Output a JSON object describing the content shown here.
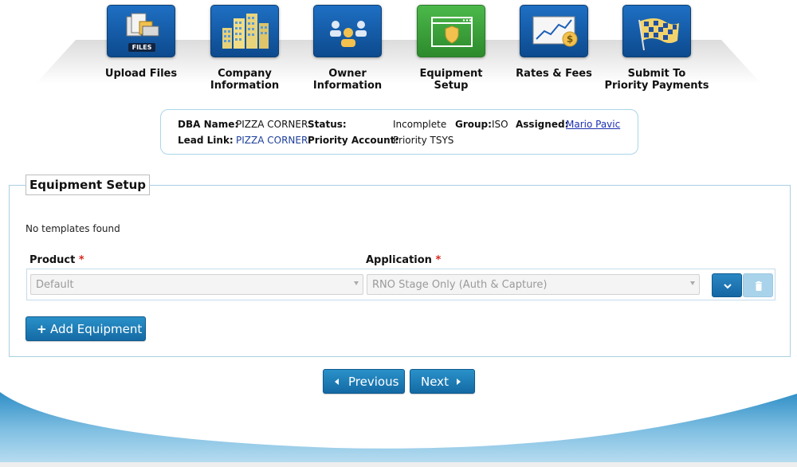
{
  "steps": [
    {
      "label_line1": "Upload Files",
      "label_line2": "",
      "tile_text": "FILES",
      "icon": "files-icon"
    },
    {
      "label_line1": "Company",
      "label_line2": "Information",
      "icon": "buildings-icon"
    },
    {
      "label_line1": "Owner",
      "label_line2": "Information",
      "icon": "people-icon"
    },
    {
      "label_line1": "Equipment",
      "label_line2": "Setup",
      "icon": "browser-shield-icon",
      "active": true
    },
    {
      "label_line1": "Rates & Fees",
      "label_line2": "",
      "icon": "chart-dollar-icon"
    },
    {
      "label_line1": "Submit To",
      "label_line2": "Priority Payments",
      "icon": "checkered-flag-icon"
    }
  ],
  "merchant": {
    "dba_label": "DBA Name:",
    "dba_value": "PIZZA CORNER",
    "status_label": "Status:",
    "status_value": "Incomplete",
    "group_label": "Group:",
    "group_value": "ISO",
    "assigned_label": "Assigned:",
    "assigned_value": "Mario Pavic",
    "lead_label": "Lead Link:",
    "lead_value": "PIZZA CORNER",
    "priority_label": "Priority Account:",
    "priority_value": "Priority TSYS"
  },
  "equipment": {
    "legend": "Equipment Setup",
    "no_templates": "No templates found",
    "product_label": "Product",
    "application_label": "Application",
    "required_mark": "*",
    "product_value": "Default",
    "application_value": "RNO Stage Only (Auth & Capture)",
    "add_button": "Add Equipment",
    "add_icon": "+"
  },
  "nav": {
    "previous": "Previous",
    "next": "Next"
  },
  "colors": {
    "tile_blue": "#1e6fc3",
    "tile_green": "#4bb84a",
    "button_blue": "#1a7db8",
    "required_red": "#d9261c"
  }
}
